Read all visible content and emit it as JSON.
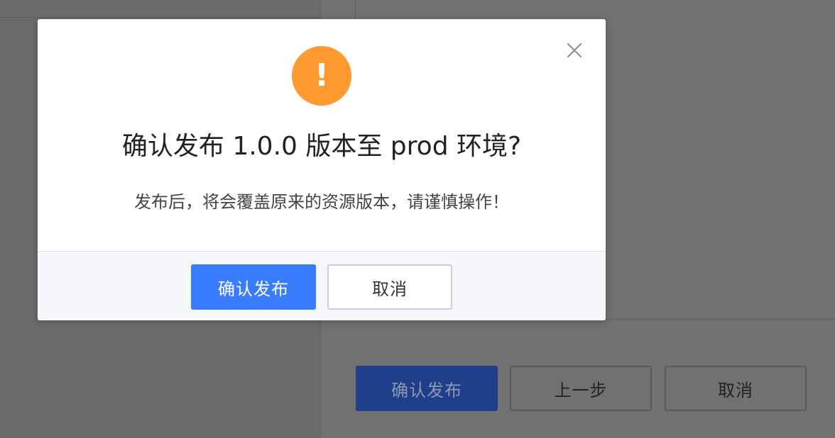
{
  "dialog": {
    "title": "确认发布 1.0.0 版本至 prod 环境?",
    "message": "发布后，将会覆盖原来的资源版本，请谨慎操作！",
    "warning_glyph": "!",
    "confirm_label": "确认发布",
    "cancel_label": "取消",
    "icons": {
      "warning": "warning-icon",
      "close": "close-icon"
    },
    "colors": {
      "warning": "#ff9a2e",
      "primary": "#3a7cff"
    }
  },
  "background": {
    "buttons": {
      "confirm_label": "确认发布",
      "prev_label": "上一步",
      "cancel_label": "取消"
    },
    "colors": {
      "primary": "#1f3f8a"
    }
  }
}
